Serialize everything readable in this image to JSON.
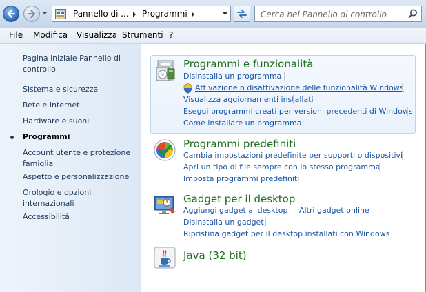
{
  "address_bar": {
    "breadcrumbs": [
      "Pannello di ...",
      "Programmi"
    ],
    "search_placeholder": "Cerca nel Pannello di controllo"
  },
  "menu": {
    "items": [
      "File",
      "Modifica",
      "Visualizza",
      "Strumenti",
      "?"
    ]
  },
  "sidebar": {
    "items": [
      {
        "label": "Pagina iniziale Pannello di controllo"
      },
      {
        "label": "Sistema e sicurezza"
      },
      {
        "label": "Rete e Internet"
      },
      {
        "label": "Hardware e suoni"
      },
      {
        "label": "Programmi",
        "current": true
      },
      {
        "label": "Account utente e protezione famiglia"
      },
      {
        "label": "Aspetto e personalizzazione"
      },
      {
        "label": "Orologio e opzioni internazionali"
      },
      {
        "label": "Accessibilità"
      }
    ]
  },
  "categories": [
    {
      "title": "Programmi e funzionalità",
      "icon": "programs-features-icon",
      "tasks": [
        "Disinstalla un programma",
        "Attivazione o disattivazione delle funzionalità Windows",
        "Visualizza aggiornamenti installati",
        "Esegui programmi creati per versioni precedenti di Windows",
        "Come installare un programma"
      ]
    },
    {
      "title": "Programmi predefiniti",
      "icon": "default-programs-icon",
      "tasks": [
        "Cambia impostazioni predefinite per supporti o dispositivi",
        "Apri un tipo di file sempre con lo stesso programma",
        "Imposta programmi predefiniti"
      ]
    },
    {
      "title": "Gadget per il desktop",
      "icon": "desktop-gadgets-icon",
      "tasks": [
        "Aggiungi gadget al desktop",
        "Altri gadget online",
        "Disinstalla un gadget",
        "Ripristina gadget per il desktop installati con Windows"
      ]
    },
    {
      "title": "Java (32 bit)",
      "icon": "java-icon",
      "tasks": []
    }
  ],
  "colors": {
    "category_title": "#1e6e1e",
    "link": "#1a55a5",
    "sidebar_link": "#1e395b"
  }
}
